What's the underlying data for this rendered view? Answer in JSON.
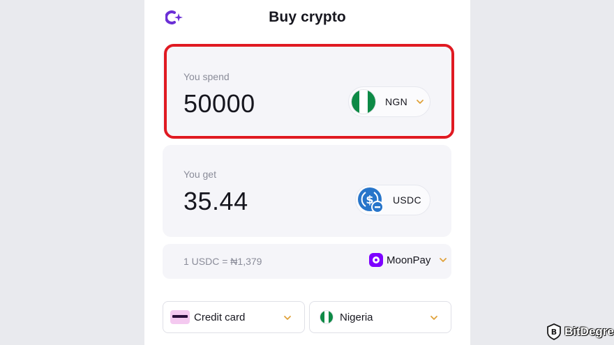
{
  "header": {
    "title": "Buy crypto",
    "logo_icon": "plus-sparkle-logo"
  },
  "spend": {
    "label": "You spend",
    "amount": "50000",
    "currency": "NGN",
    "flag": "nigeria-flag"
  },
  "get": {
    "label": "You get",
    "amount": "35.44",
    "currency": "USDC",
    "icon": "usdc-icon"
  },
  "rate": {
    "text": "1 USDC = ₦1,379",
    "provider": "MoonPay",
    "provider_icon": "moonpay-logo"
  },
  "payment_method": {
    "label": "Credit card",
    "icon": "credit-card-icon"
  },
  "country": {
    "label": "Nigeria",
    "icon": "nigeria-flag"
  },
  "watermark": {
    "brand": "BitDegree"
  },
  "colors": {
    "accent": "#6b2fd6",
    "highlight": "#e01a22",
    "chevron": "#e0a23a",
    "card_bg": "#f5f5f9",
    "usdc_blue": "#2775ca",
    "moonpay_purple": "#7d00ff",
    "nigeria_green": "#0d8a46"
  }
}
